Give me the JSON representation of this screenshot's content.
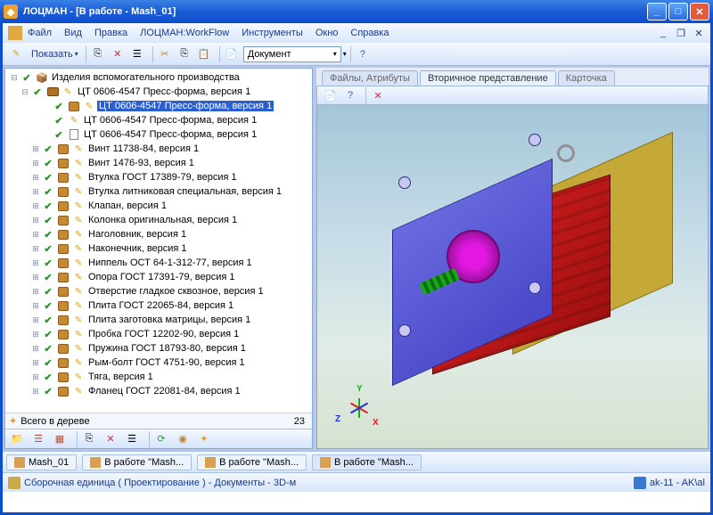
{
  "title": "ЛОЦМАН - [В работе - Mash_01]",
  "menu": {
    "file": "Файл",
    "view": "Вид",
    "edit": "Правка",
    "workflow": "ЛОЦМАН:WorkFlow",
    "tools": "Инструменты",
    "window": "Окно",
    "help": "Справка"
  },
  "toolbar": {
    "show": "Показать",
    "document": "Документ"
  },
  "tree": {
    "root": "Изделия вспомогательного производства",
    "node0": "ЦТ 0606-4547 Пресс-форма, версия 1",
    "selected": "ЦТ 0606-4547 Пресс-форма, версия 1",
    "node0b": "ЦТ 0606-4547 Пресс-форма, версия 1",
    "node0c": "ЦТ 0606-4547 Пресс-форма, версия 1",
    "items": [
      "Винт 11738-84, версия 1",
      "Винт 1476-93, версия 1",
      "Втулка ГОСТ 17389-79, версия 1",
      "Втулка литниковая специальная, версия 1",
      "Клапан, версия 1",
      "Колонка оригинальная, версия 1",
      "Наголовник, версия 1",
      "Наконечник, версия 1",
      "Ниппель ОСТ 64-1-312-77, версия 1",
      "Опора ГОСТ 17391-79, версия 1",
      "Отверстие гладкое сквозное, версия 1",
      "Плита ГОСТ 22065-84, версия 1",
      "Плита заготовка матрицы, версия 1",
      "Пробка ГОСТ 12202-90, версия 1",
      "Пружина ГОСТ 18793-80, версия 1",
      "Рым-болт ГОСТ 4751-90, версия 1",
      "Тяга, версия 1",
      "Фланец ГОСТ 22081-84, версия 1"
    ],
    "footer": "Всего в дереве",
    "count": "23"
  },
  "rtabs": {
    "t1": "Файлы, Атрибуты",
    "t2": "Вторичное представление",
    "t3": "Карточка"
  },
  "axes": {
    "x": "X",
    "y": "Y",
    "z": "Z"
  },
  "tasks": {
    "t1": "Mash_01",
    "t2": "В работе \"Mash...",
    "t3": "В работе \"Mash...",
    "t4": "В работе \"Mash..."
  },
  "status": {
    "left": "Сборочная единица ( Проектирование ) - Документы - 3D-м",
    "right": "ak-11 - AK\\al"
  }
}
